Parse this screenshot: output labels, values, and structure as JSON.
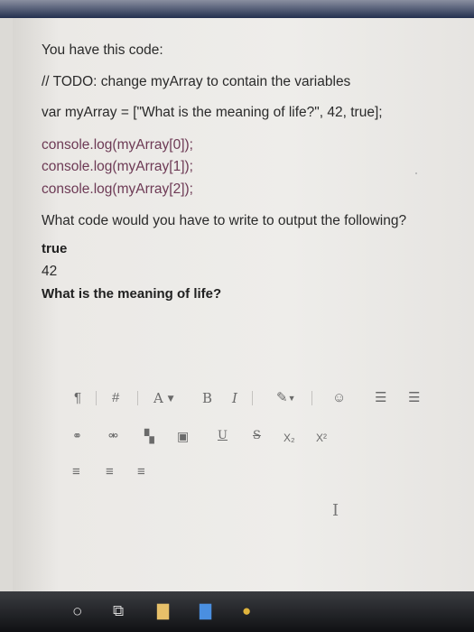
{
  "question": {
    "intro": "You have this code:",
    "comment": "// TODO: change myArray to contain the variables",
    "declaration": "var myArray = [\"What is the meaning of life?\", 42, true];",
    "code_lines": [
      "console.log(myArray[0]);",
      "console.log(myArray[1]);",
      "console.log(myArray[2]);"
    ],
    "prompt": "What code would you have to write to output the following?",
    "output_lines": [
      "true",
      "42",
      "What is the meaning of life?"
    ]
  },
  "toolbar": {
    "paragraph": "¶",
    "heading": "#",
    "font_size": "A",
    "bold": "B",
    "italic": "I",
    "underline": "U",
    "strike": "S",
    "subscript": "X₂",
    "superscript": "X²",
    "emoji": "☺",
    "bullet_list": "☰",
    "numbered_list": "☰",
    "align_left": "≡",
    "align_center": "≡",
    "align_right": "≡"
  },
  "icons": [
    "paragraph-icon",
    "heading-icon",
    "font-size-icon",
    "bold-icon",
    "italic-icon",
    "paint-icon",
    "emoji-icon",
    "bullet-list-icon",
    "numbered-list-icon",
    "link-icon",
    "unlink-icon",
    "copy-icon",
    "image-icon",
    "underline-icon",
    "strikethrough-icon",
    "subscript-icon",
    "superscript-icon",
    "align-left-icon",
    "align-center-icon",
    "align-right-icon",
    "cortana-icon",
    "task-view-icon",
    "file-explorer-icon",
    "chrome-icon"
  ],
  "colors": {
    "code": "#6d3a55",
    "text": "#2a2a2a",
    "page": "#eeedea",
    "taskbar": "#15161a"
  }
}
